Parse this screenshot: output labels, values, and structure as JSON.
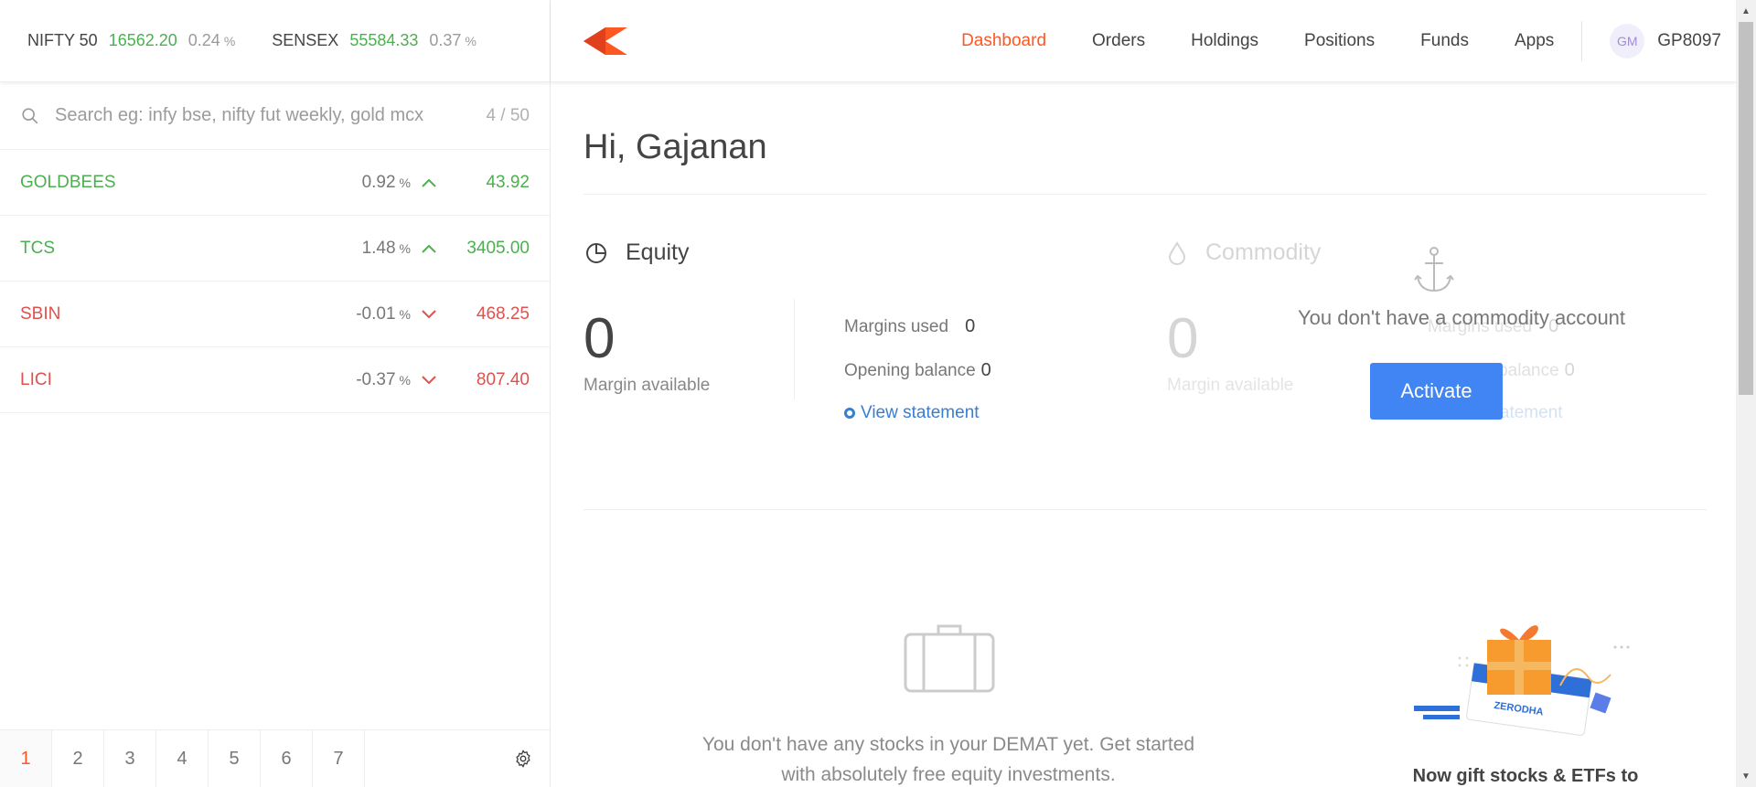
{
  "indices": [
    {
      "name": "NIFTY 50",
      "value": "16562.20",
      "change": "0.24",
      "unit": "%"
    },
    {
      "name": "SENSEX",
      "value": "55584.33",
      "change": "0.37",
      "unit": "%"
    }
  ],
  "search": {
    "placeholder": "Search eg: infy bse, nifty fut weekly, gold mcx",
    "count": "4 / 50"
  },
  "watchlist": [
    {
      "symbol": "GOLDBEES",
      "change": "0.92",
      "unit": "%",
      "ltp": "43.92",
      "direction": "up"
    },
    {
      "symbol": "TCS",
      "change": "1.48",
      "unit": "%",
      "ltp": "3405.00",
      "direction": "up"
    },
    {
      "symbol": "SBIN",
      "change": "-0.01",
      "unit": "%",
      "ltp": "468.25",
      "direction": "down"
    },
    {
      "symbol": "LICI",
      "change": "-0.37",
      "unit": "%",
      "ltp": "807.40",
      "direction": "down"
    }
  ],
  "pages": [
    "1",
    "2",
    "3",
    "4",
    "5",
    "6",
    "7"
  ],
  "nav": {
    "dashboard": "Dashboard",
    "orders": "Orders",
    "holdings": "Holdings",
    "positions": "Positions",
    "funds": "Funds",
    "apps": "Apps"
  },
  "user": {
    "initials": "GM",
    "id": "GP8097"
  },
  "greeting": "Hi, Gajanan",
  "equity": {
    "title": "Equity",
    "margin_available_value": "0",
    "margin_available_label": "Margin available",
    "margins_used_label": "Margins used",
    "margins_used_value": "0",
    "opening_balance_label": "Opening balance",
    "opening_balance_value": "0",
    "view_statement": "View statement"
  },
  "commodity": {
    "title": "Commodity",
    "margin_available_value": "0",
    "margin_available_label": "Margin available",
    "margins_used_label": "Margins used",
    "margins_used_value": "0",
    "opening_balance_label": "Opening balance",
    "opening_balance_value": "0",
    "view_statement": "View statement",
    "no_account_text": "You don't have a commodity account",
    "activate_label": "Activate"
  },
  "demat": {
    "empty_text": "You don't have any stocks in your DEMAT yet. Get started with absolutely free equity investments."
  },
  "gift": {
    "brand": "ZERODHA",
    "text": "Now gift stocks & ETFs to"
  },
  "colors": {
    "accent": "#ff5722",
    "up": "#4caf50",
    "down": "#df514c",
    "link": "#387ed1",
    "button": "#4184f3"
  }
}
